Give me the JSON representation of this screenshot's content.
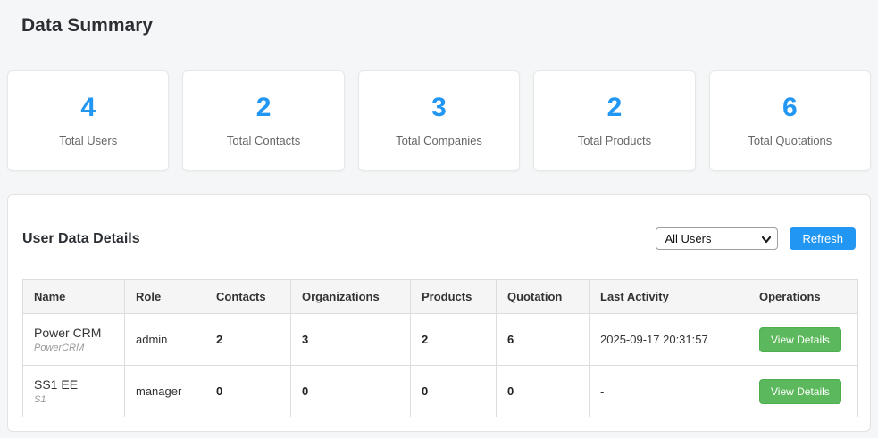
{
  "page": {
    "title": "Data Summary"
  },
  "stats": [
    {
      "value": "4",
      "label": "Total Users"
    },
    {
      "value": "2",
      "label": "Total Contacts"
    },
    {
      "value": "3",
      "label": "Total Companies"
    },
    {
      "value": "2",
      "label": "Total Products"
    },
    {
      "value": "6",
      "label": "Total Quotations"
    }
  ],
  "panel": {
    "title": "User Data Details",
    "filter": {
      "selected": "All Users"
    },
    "refresh_label": "Refresh"
  },
  "table": {
    "columns": [
      "Name",
      "Role",
      "Contacts",
      "Organizations",
      "Products",
      "Quotation",
      "Last Activity",
      "Operations"
    ],
    "rows": [
      {
        "name": "Power CRM",
        "username": "PowerCRM",
        "role": "admin",
        "contacts": "2",
        "organizations": "3",
        "products": "2",
        "quotation": "6",
        "last_activity": "2025-09-17 20:31:57",
        "action": "View Details"
      },
      {
        "name": "SS1 EE",
        "username": "S1",
        "role": "manager",
        "contacts": "0",
        "organizations": "0",
        "products": "0",
        "quotation": "0",
        "last_activity": "-",
        "action": "View Details"
      }
    ]
  },
  "colors": {
    "accent": "#2196f3",
    "success": "#5cb85c"
  }
}
